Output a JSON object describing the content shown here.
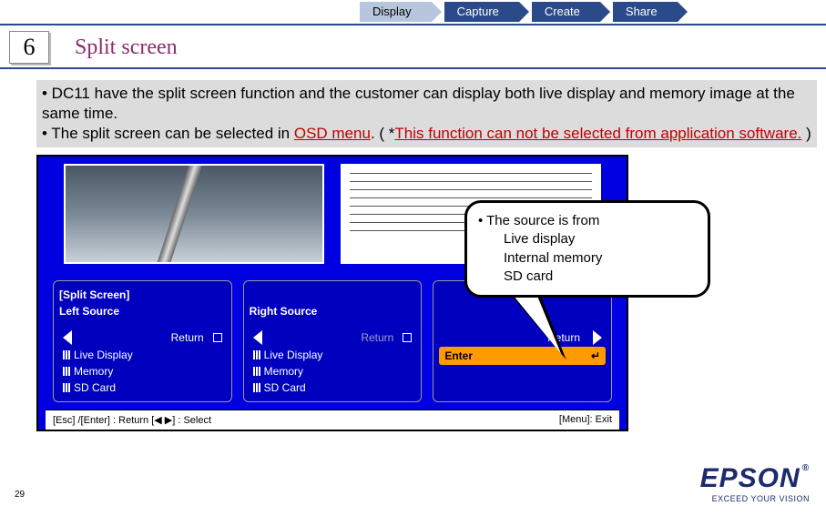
{
  "nav": {
    "items": [
      "Display",
      "Capture",
      "Create",
      "Share"
    ]
  },
  "section": {
    "number": "6",
    "title": "Split screen"
  },
  "body": {
    "line1a": "• DC11 have the split screen function and the customer can display both live display and memory image at the same time.",
    "line2a": "• The split screen can be selected in ",
    "line2b": "OSD menu",
    "line2c": ". ( *",
    "line2d": "This function can not be selected from application software.",
    "line2e": " )"
  },
  "osd": {
    "panel1_title": "[Split Screen]",
    "panel1_sub": "Left Source",
    "panel2_sub": "Right Source",
    "return": "Return",
    "opt_live": "Live Display",
    "opt_memory": "Memory",
    "opt_sd": "SD Card",
    "enter": "Enter",
    "footer_left": "[Esc] /[Enter] : Return  [◀ ▶] : Select",
    "footer_right": "[Menu]: Exit"
  },
  "callout": {
    "lead": "• The source is from",
    "s1": "Live display",
    "s2": "Internal memory",
    "s3": "SD card"
  },
  "logo": {
    "brand": "EPSON",
    "tagline": "EXCEED YOUR VISION"
  },
  "page": "29"
}
